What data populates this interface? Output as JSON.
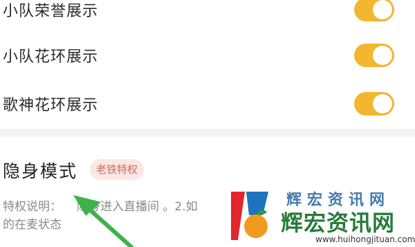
{
  "settings": {
    "rows": [
      {
        "label": "小队荣誉展示",
        "enabled": true
      },
      {
        "label": "小队花环展示",
        "enabled": true
      },
      {
        "label": "歌神花环展示",
        "enabled": true
      }
    ],
    "toggle_color": "#f3b72f"
  },
  "invisible_mode": {
    "title": "隐身模式",
    "badge": "老铁特权",
    "description_part1": "特权说明：",
    "description_part2": "隐身进入直播间 。2.如",
    "description_line2": "的在麦状态"
  },
  "watermark": {
    "top_text": "辉宏资讯网",
    "title": "辉宏资讯网",
    "url": "www.huihongjituan.com"
  },
  "colors": {
    "arrow": "#3db24a",
    "badge_bg": "#fbe7e4",
    "badge_text": "#d8685a"
  }
}
